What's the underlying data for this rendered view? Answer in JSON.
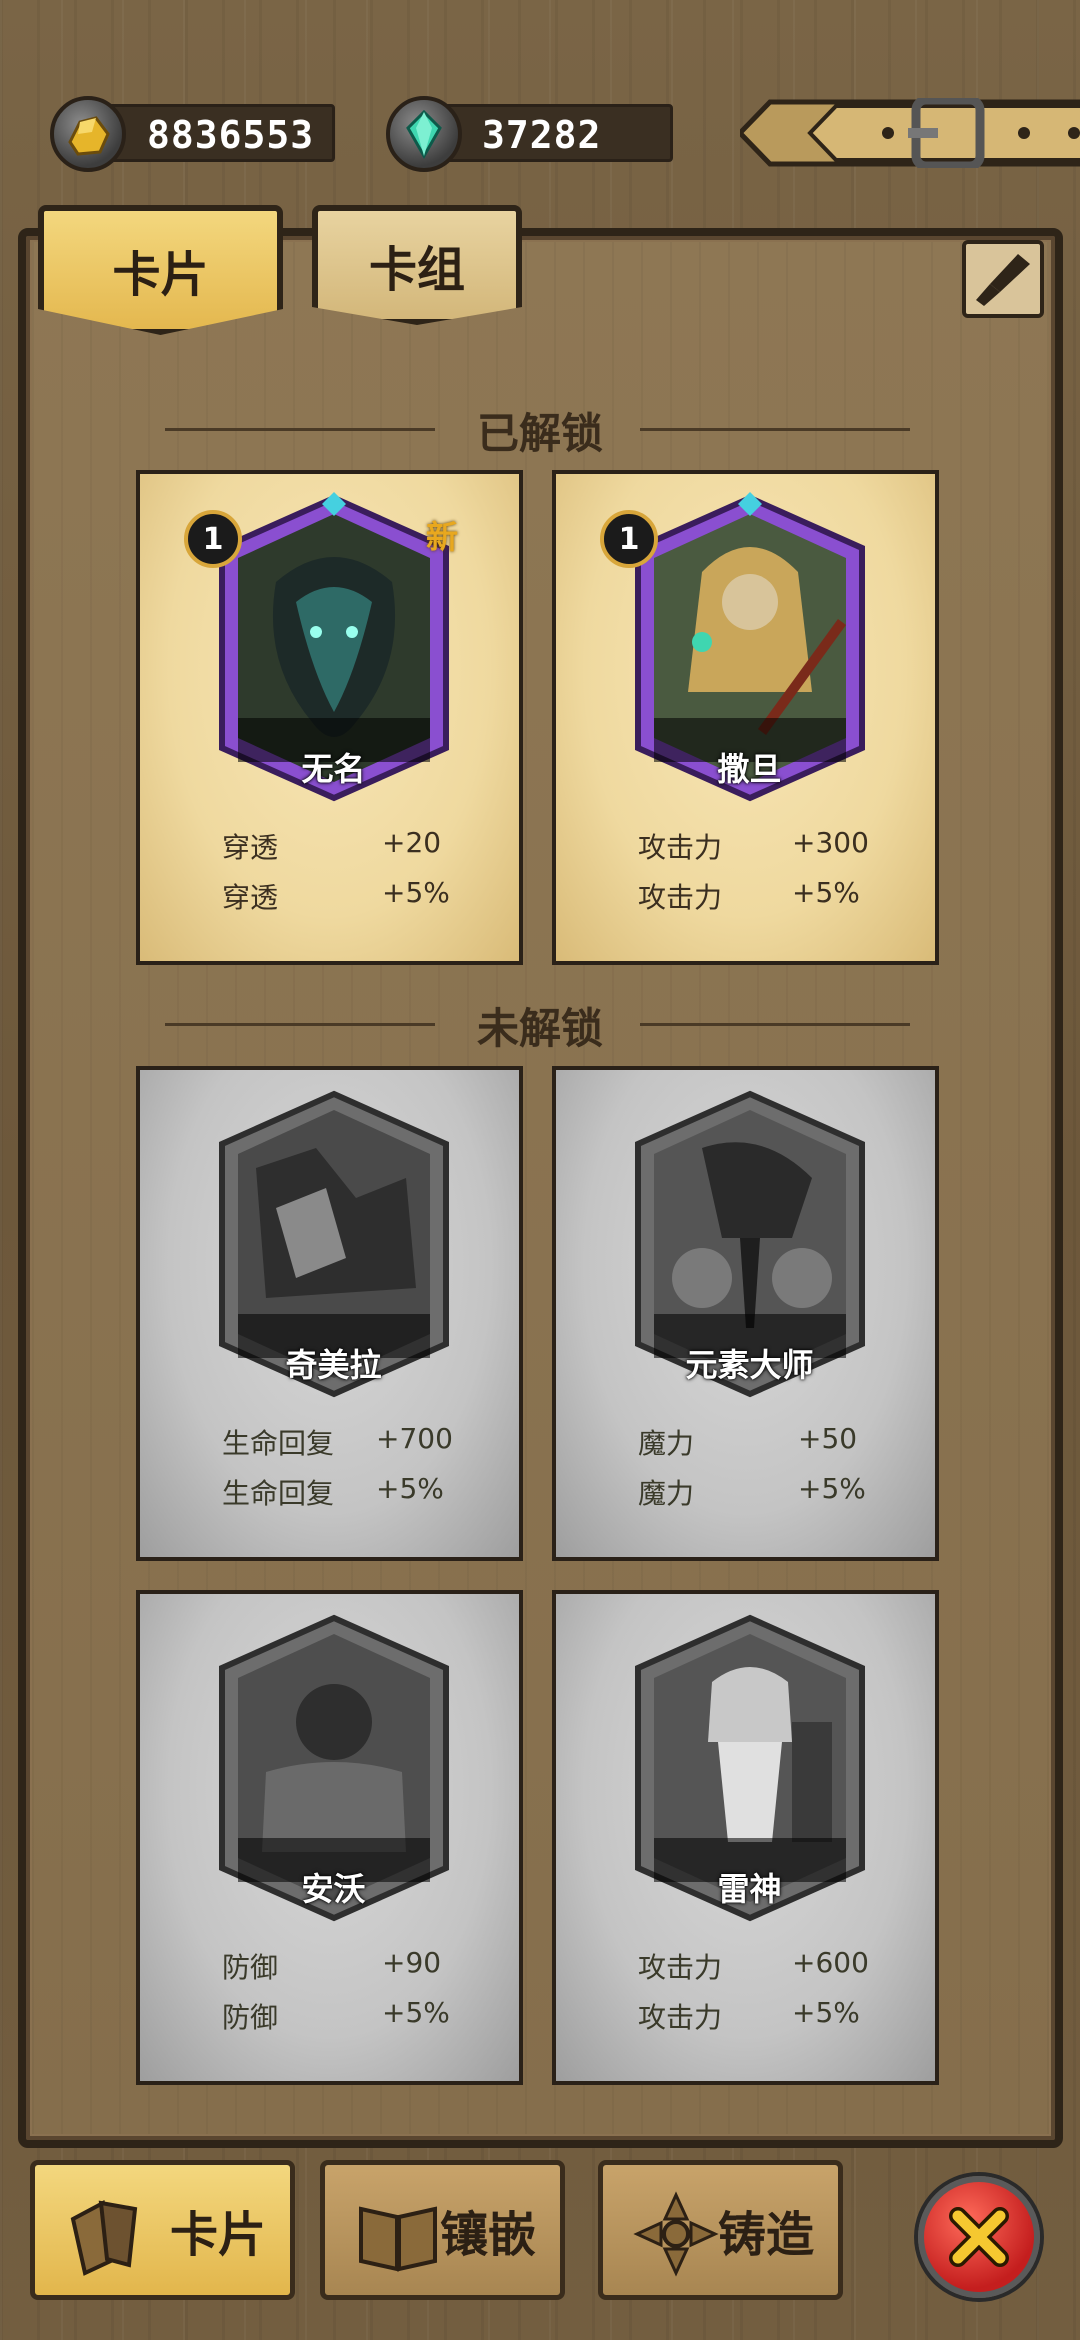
{
  "resources": {
    "gold": {
      "icon": "gold-ore-icon",
      "value": "8836553"
    },
    "gem": {
      "icon": "crystal-gem-icon",
      "value": "37282"
    }
  },
  "tabs": [
    {
      "label": "卡片",
      "active": true
    },
    {
      "label": "卡组",
      "active": false
    }
  ],
  "sections": {
    "unlocked": "已解锁",
    "locked": "未解锁"
  },
  "badges": {
    "new": "新"
  },
  "cards": [
    {
      "name": "无名",
      "level": "1",
      "is_new": true,
      "locked": false,
      "stats": [
        {
          "label": "穿透",
          "value": "+20"
        },
        {
          "label": "穿透",
          "value": "+5%"
        }
      ]
    },
    {
      "name": "撒旦",
      "level": "1",
      "is_new": false,
      "locked": false,
      "stats": [
        {
          "label": "攻击力",
          "value": "+300"
        },
        {
          "label": "攻击力",
          "value": "+5%"
        }
      ]
    },
    {
      "name": "奇美拉",
      "locked": true,
      "stats": [
        {
          "label": "生命回复",
          "value": "+700"
        },
        {
          "label": "生命回复",
          "value": "+5%"
        }
      ]
    },
    {
      "name": "元素大师",
      "locked": true,
      "stats": [
        {
          "label": "魔力",
          "value": "+50"
        },
        {
          "label": "魔力",
          "value": "+5%"
        }
      ]
    },
    {
      "name": "安沃",
      "locked": true,
      "stats": [
        {
          "label": "防御",
          "value": "+90"
        },
        {
          "label": "防御",
          "value": "+5%"
        }
      ]
    },
    {
      "name": "雷神",
      "locked": true,
      "stats": [
        {
          "label": "攻击力",
          "value": "+600"
        },
        {
          "label": "攻击力",
          "value": "+5%"
        }
      ]
    }
  ],
  "bottom_nav": [
    {
      "label": "卡片",
      "icon": "cards-icon",
      "active": true
    },
    {
      "label": "镶嵌",
      "icon": "book-icon",
      "active": false
    },
    {
      "label": "铸造",
      "icon": "forge-icon",
      "active": false
    }
  ],
  "colors": {
    "accent_gold": "#e4b84f",
    "frame_purple": "#8a4fd0",
    "close_red": "#c41e1e"
  }
}
